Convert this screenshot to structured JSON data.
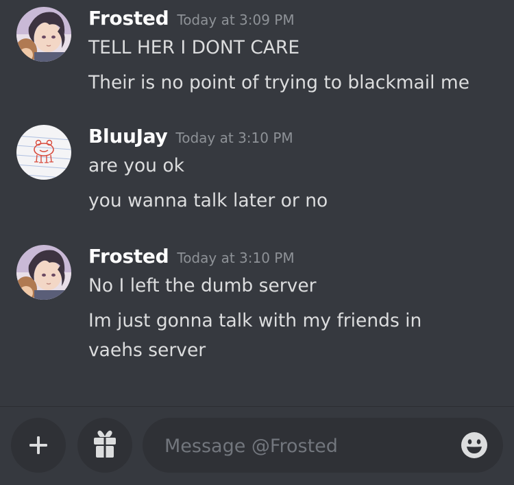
{
  "messages": [
    {
      "username": "Frosted",
      "timestamp": "Today at 3:09 PM",
      "avatar": "anime-boy-avatar",
      "lines": [
        "TELL HER I DONT CARE",
        "Their is no point of trying to blackmail me"
      ]
    },
    {
      "username": "BluuJay",
      "timestamp": "Today at 3:10 PM",
      "avatar": "frog-doodle-avatar",
      "lines": [
        "are you ok",
        "you wanna talk later or no"
      ]
    },
    {
      "username": "Frosted",
      "timestamp": "Today at 3:10 PM",
      "avatar": "anime-boy-avatar",
      "lines": [
        "No I left the dumb server",
        "Im just gonna talk with my friends in vaehs server"
      ]
    }
  ],
  "composer": {
    "placeholder": "Message @Frosted",
    "add_icon": "plus-icon",
    "gift_icon": "gift-icon",
    "emoji_icon": "emoji-icon"
  },
  "colors": {
    "background": "#36393f",
    "input_background": "#2f3136",
    "username": "#ffffff",
    "message_text": "#dcddde",
    "timestamp": "#8e9297",
    "placeholder": "#72767d"
  }
}
